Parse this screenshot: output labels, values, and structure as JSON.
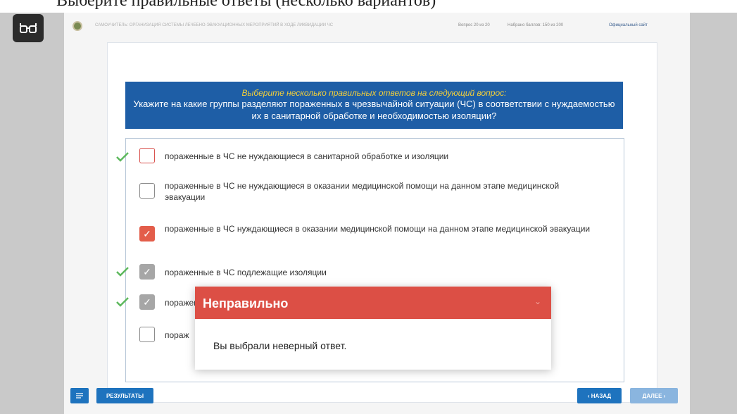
{
  "header_caption": "Выберите правильные ответы (несколько вариантов)",
  "topbar": {
    "system_title": "САМОУЧИТЕЛЬ: ОРГАНИЗАЦИЯ СИСТЕМЫ ЛЕЧЕБНО-ЭВАКУАЦИОННЫХ МЕРОПРИЯТИЙ В ХОДЕ ЛИКВИДАЦИИ ЧС",
    "question_count": "Вопрос 20 из 20",
    "score": "Набрано баллов: 150 из 200",
    "official_site": "Официальный сайт"
  },
  "question": {
    "instruction": "Выберите несколько правильных ответов на следующий вопрос:",
    "text": "Укажите на какие группы разделяют пораженных в чрезвычайной ситуации (ЧС) в соответствии с нуждаемостью их в санитарной обработке и необходимостью изоляции?"
  },
  "answers": [
    {
      "text": "пораженные в ЧС не нуждающиеся в санитарной обработке и изоляции",
      "state": "missed-correct",
      "tick": true
    },
    {
      "text": "пораженные в ЧС не нуждающиеся в оказании медицинской помощи на данном этапе медицинской эвакуации",
      "state": "unchecked",
      "tick": false
    },
    {
      "text": "пораженные в ЧС нуждающиеся в оказании медицинской помощи на данном этапе медицинской эвакуации",
      "state": "checked-wrong",
      "tick": false
    },
    {
      "text": "пораженные в ЧС подлежащие изоляции",
      "state": "checked-correct",
      "tick": true
    },
    {
      "text": "поражен",
      "state": "checked-correct",
      "tick": true
    },
    {
      "text": "пораж",
      "state": "unchecked",
      "tick": false
    }
  ],
  "modal": {
    "title": "Неправильно",
    "message": "Вы выбрали неверный ответ."
  },
  "buttons": {
    "results": "РЕЗУЛЬТАТЫ",
    "back": "‹ НАЗАД",
    "next": "ДАЛЕЕ ›"
  },
  "colors": {
    "question_bg": "#1e5ea6",
    "instruction_text": "#f3cf3a",
    "modal_header": "#dc4f45",
    "button_primary": "#1e73be",
    "tick_green": "#5cb85c"
  },
  "icons": {
    "reader_mode": "glasses-icon",
    "menu": "list-icon",
    "correct": "checkmark-icon",
    "collapse": "chevron-down-icon"
  }
}
